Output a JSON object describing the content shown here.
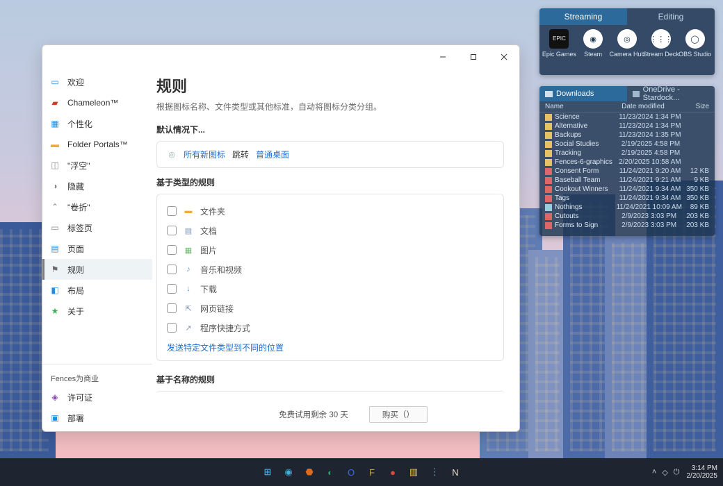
{
  "sidebar": {
    "items": [
      {
        "label": "欢迎",
        "icon": "welcome",
        "color": "#1f8fe4"
      },
      {
        "label": "Chameleon™",
        "icon": "chameleon",
        "color": "#d03b2a"
      },
      {
        "label": "个性化",
        "icon": "personalize",
        "color": "#1f8fe4"
      },
      {
        "label": "Folder Portals™",
        "icon": "folder",
        "color": "#f0a93a"
      },
      {
        "label": "\"浮空\"",
        "icon": "float",
        "color": "#888"
      },
      {
        "label": "隐藏",
        "icon": "hide",
        "color": "#888"
      },
      {
        "label": "\"卷折\"",
        "icon": "rollup",
        "color": "#888"
      },
      {
        "label": "标签页",
        "icon": "tabs",
        "color": "#888"
      },
      {
        "label": "页面",
        "icon": "pages",
        "color": "#1f8fe4"
      },
      {
        "label": "规则",
        "icon": "rules",
        "color": "#6a6a6a"
      },
      {
        "label": "布局",
        "icon": "layout",
        "color": "#1f8fe4"
      },
      {
        "label": "关于",
        "icon": "about",
        "color": "#3cb056"
      }
    ],
    "biz_header": "Fences为商业",
    "biz_items": [
      {
        "label": "许可证",
        "icon": "license",
        "color": "#8a3fb3"
      },
      {
        "label": "部署",
        "icon": "deploy",
        "color": "#1f8fe4"
      }
    ],
    "selected_index": 9
  },
  "main": {
    "title": "规则",
    "subtitle": "根据图标名称、文件类型或其他标准，自动将图标分类分组。",
    "default_header": "默认情况下...",
    "default_row": {
      "prefix": "所有新图标",
      "mid": "跳转",
      "target": "普通桌面"
    },
    "type_header": "基于类型的规则",
    "type_rules": [
      {
        "label": "文件夹",
        "icon": "folder",
        "color": "#f0a93a"
      },
      {
        "label": "文档",
        "icon": "doc",
        "color": "#7a93b5"
      },
      {
        "label": "图片",
        "icon": "image",
        "color": "#6fb86f"
      },
      {
        "label": "音乐和视频",
        "icon": "media",
        "color": "#5a9bd5"
      },
      {
        "label": "下载",
        "icon": "download",
        "color": "#5a9bd5"
      },
      {
        "label": "网页链接",
        "icon": "link",
        "color": "#7a93b5"
      },
      {
        "label": "程序快捷方式",
        "icon": "shortcut",
        "color": "#7a93b5"
      }
    ],
    "more_link": "发送特定文件类型到不同的位置",
    "name_header": "基于名称的规则"
  },
  "trial": {
    "text": "免费试用剩余 30 天",
    "buy": "购买（）"
  },
  "applet": {
    "tabs": [
      "Streaming",
      "Editing"
    ],
    "selected": 0,
    "items": [
      {
        "label": "Epic Games",
        "badge": "EPIC"
      },
      {
        "label": "Steam",
        "badge": "◉"
      },
      {
        "label": "Camera Hub",
        "badge": "◎"
      },
      {
        "label": "Stream Deck",
        "badge": "⋮⋮⋮"
      },
      {
        "label": "OBS Studio",
        "badge": "◯"
      }
    ]
  },
  "fence": {
    "tabs": [
      "Downloads",
      "OneDrive - Stardock..."
    ],
    "selected": 0,
    "headers": {
      "name": "Name",
      "date": "Date modified",
      "size": "Size"
    },
    "rows": [
      {
        "t": "folder",
        "name": "Science",
        "date": "11/23/2024 1:34 PM",
        "size": ""
      },
      {
        "t": "folder",
        "name": "Alternative",
        "date": "11/23/2024 1:34 PM",
        "size": ""
      },
      {
        "t": "folder",
        "name": "Backups",
        "date": "11/23/2024 1:35 PM",
        "size": ""
      },
      {
        "t": "folder",
        "name": "Social Studies",
        "date": "2/19/2025 4:58 PM",
        "size": ""
      },
      {
        "t": "folder",
        "name": "Tracking",
        "date": "2/19/2025 4:58 PM",
        "size": ""
      },
      {
        "t": "folder",
        "name": "Fences-6-graphics",
        "date": "2/20/2025 10:58 AM",
        "size": ""
      },
      {
        "t": "doc",
        "name": "Consent Form",
        "date": "11/24/2021 9:20 AM",
        "size": "12 KB"
      },
      {
        "t": "doc",
        "name": "Baseball Team",
        "date": "11/24/2021 9:21 AM",
        "size": "9 KB"
      },
      {
        "t": "doc",
        "name": "Cookout Winners",
        "date": "11/24/2021 9:34 AM",
        "size": "350 KB"
      },
      {
        "t": "doc",
        "name": "Tags",
        "date": "11/24/2021 9:34 AM",
        "size": "350 KB"
      },
      {
        "t": "txt",
        "name": "Nothings",
        "date": "11/24/2021 10:09 AM",
        "size": "89 KB"
      },
      {
        "t": "doc",
        "name": "Cutouts",
        "date": "2/9/2023 3:03 PM",
        "size": "203 KB"
      },
      {
        "t": "doc",
        "name": "Forms to Sign",
        "date": "2/9/2023 3:03 PM",
        "size": "203 KB"
      }
    ]
  },
  "taskbar": {
    "apps": [
      {
        "name": "start",
        "glyph": "⊞",
        "color": "#4cc2ff"
      },
      {
        "name": "edge",
        "glyph": "◉",
        "color": "#3fb1d8"
      },
      {
        "name": "office",
        "glyph": "⬣",
        "color": "#e06a1c"
      },
      {
        "name": "app4",
        "glyph": "◐",
        "color": "#2e9b65"
      },
      {
        "name": "app5",
        "glyph": "O",
        "color": "#3a6fe0"
      },
      {
        "name": "app6",
        "glyph": "F",
        "color": "#c7a35c"
      },
      {
        "name": "app7",
        "glyph": "●",
        "color": "#d94b3b"
      },
      {
        "name": "explorer",
        "glyph": "▥",
        "color": "#f0c64a"
      },
      {
        "name": "app9",
        "glyph": "⋮",
        "color": "#8aa3b8"
      },
      {
        "name": "app10",
        "glyph": "N",
        "color": "#e7e2cc"
      }
    ],
    "clock": {
      "time": "3:14 PM",
      "date": "2/20/2025"
    },
    "tray": [
      "˄",
      "◇",
      "⏻"
    ]
  }
}
